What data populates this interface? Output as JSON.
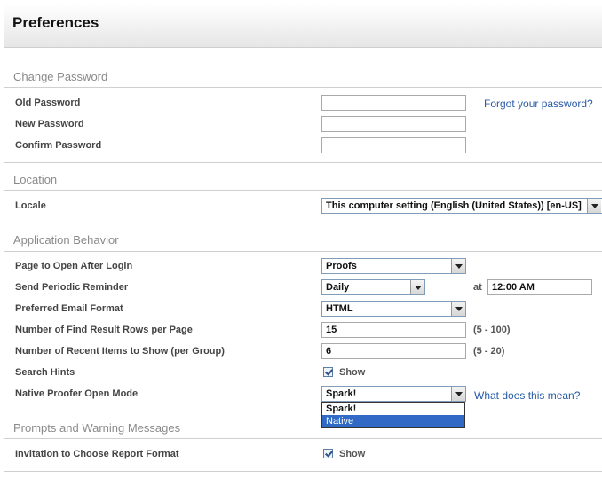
{
  "page": {
    "title": "Preferences"
  },
  "change_password": {
    "title": "Change Password",
    "old_label": "Old Password",
    "new_label": "New Password",
    "confirm_label": "Confirm Password",
    "forgot_link": "Forgot your password?"
  },
  "location": {
    "title": "Location",
    "locale_label": "Locale",
    "locale_value": "This computer setting (English (United States)) [en-US]"
  },
  "app_behavior": {
    "title": "Application Behavior",
    "page_open_label": "Page to Open After Login",
    "page_open_value": "Proofs",
    "reminder_label": "Send Periodic Reminder",
    "reminder_value": "Daily",
    "at_label": "at",
    "time_value": "12:00 AM",
    "email_format_label": "Preferred Email Format",
    "email_format_value": "HTML",
    "find_rows_label": "Number of Find Result Rows per Page",
    "find_rows_value": "15",
    "find_rows_range": "(5 - 100)",
    "recent_items_label": "Number of Recent Items to Show (per Group)",
    "recent_items_value": "6",
    "recent_items_range": "(5 - 20)",
    "search_hints_label": "Search Hints",
    "search_hints_checkbox_label": "Show",
    "proofer_mode_label": "Native Proofer Open Mode",
    "proofer_mode_value": "Spark!",
    "proofer_mode_options": [
      "Spark!",
      "Native"
    ],
    "what_link": "What does this mean?"
  },
  "prompts": {
    "title": "Prompts and Warning Messages",
    "invitation_label": "Invitation to Choose Report Format",
    "invitation_checkbox_label": "Show"
  }
}
